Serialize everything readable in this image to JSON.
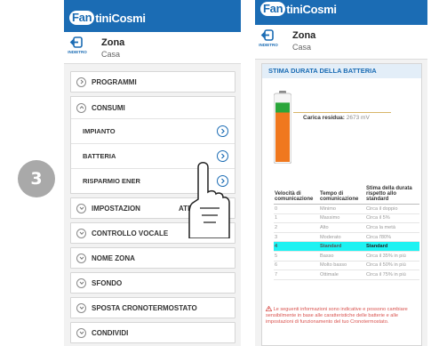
{
  "step": "3",
  "brand": {
    "part1": "Fan",
    "part2": "tiniCosmi"
  },
  "back_label": "INDIETRO",
  "zone": {
    "title": "Zona",
    "subtitle": "Casa"
  },
  "menu": {
    "programmi": "PROGRAMMI",
    "consumi": "CONSUMI",
    "consumi_items": [
      "IMPIANTO",
      "BATTERIA",
      "RISPARMIO ENER"
    ],
    "impostazioni": "IMPOSTAZION",
    "impostazioni_tail": "ATE",
    "controllo_vocale": "CONTROLLO VOCALE",
    "nome_zona": "NOME ZONA",
    "sfondo": "SFONDO",
    "sposta": "SPOSTA CRONOTERMOSTATO",
    "condividi": "CONDIVIDI"
  },
  "battery_panel": {
    "title": "STIMA DURATA DELLA BATTERIA",
    "charge_label": "Carica residua:",
    "charge_value": "2673 mV",
    "levels": {
      "green_fraction": 0.15,
      "orange_fraction": 0.75
    },
    "columns": [
      "Velocità di comunicazione",
      "Tempo di comunicazione",
      "Stima della durata rispetto allo standard"
    ],
    "rows": [
      [
        "0",
        "Minimo",
        "Circa il doppio"
      ],
      [
        "1",
        "Massimo",
        "Circa il 5%"
      ],
      [
        "2",
        "Alto",
        "Circa la metà"
      ],
      [
        "3",
        "Moderato",
        "Circa l'80%"
      ],
      [
        "4",
        "Standard",
        "Standard"
      ],
      [
        "5",
        "Basso",
        "Circa il 35% in più"
      ],
      [
        "6",
        "Molto basso",
        "Circa il 50% in più"
      ],
      [
        "7",
        "Ottimale",
        "Circa il 75% in più"
      ]
    ],
    "selected_row": 4,
    "note": "Le seguenti informazioni sono indicative e possono cambiare sensibilmente in base alle caratteristiche delle batterie e alle impostazioni di funzionamento del tuo Cronotermostato."
  },
  "colors": {
    "brand_blue": "#1b6cb4",
    "highlight_cyan": "#1ef2f2",
    "battery_orange": "#f0781e",
    "battery_green": "#2aa63a",
    "warning_red": "#d9534f"
  }
}
